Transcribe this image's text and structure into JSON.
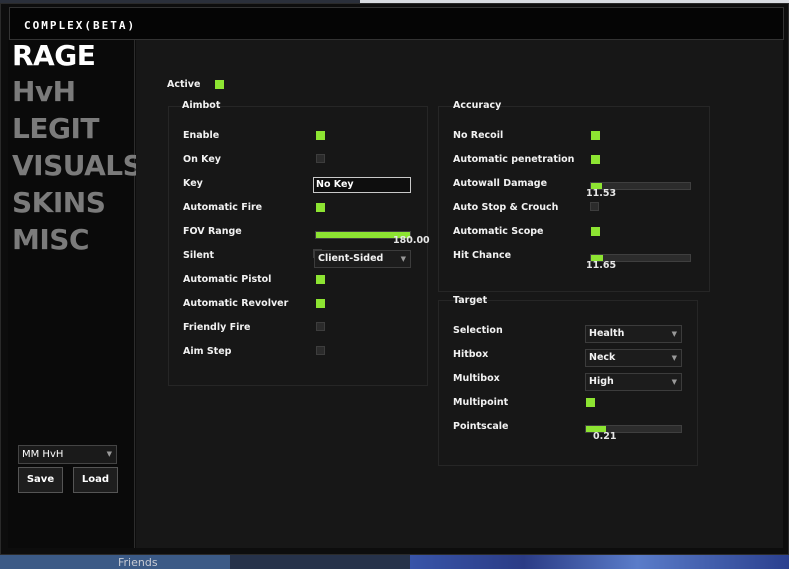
{
  "window": {
    "title": "COMPLEX(BETA)"
  },
  "sidebar": {
    "items": [
      {
        "label": "RAGE"
      },
      {
        "label": "HvH"
      },
      {
        "label": "LEGIT"
      },
      {
        "label": "VISUALS"
      },
      {
        "label": "SKINS"
      },
      {
        "label": "MISC"
      }
    ],
    "active": "RAGE",
    "config_select": "MM HvH",
    "save_label": "Save",
    "load_label": "Load"
  },
  "main": {
    "active_label": "Active",
    "active_checked": true,
    "aimbot": {
      "title": "Aimbot",
      "enable": {
        "label": "Enable",
        "checked": true
      },
      "on_key": {
        "label": "On Key",
        "checked": false
      },
      "key": {
        "label": "Key",
        "value": "No Key"
      },
      "automatic_fire": {
        "label": "Automatic Fire",
        "checked": true
      },
      "fov_range": {
        "label": "FOV Range",
        "value": "180.00",
        "fraction": 1.0
      },
      "silent": {
        "label": "Silent",
        "checked": false,
        "mode": "Client-Sided"
      },
      "automatic_pistol": {
        "label": "Automatic Pistol",
        "checked": true
      },
      "automatic_revolver": {
        "label": "Automatic Revolver",
        "checked": true
      },
      "friendly_fire": {
        "label": "Friendly Fire",
        "checked": false
      },
      "aim_step": {
        "label": "Aim Step",
        "checked": false
      }
    },
    "accuracy": {
      "title": "Accuracy",
      "no_recoil": {
        "label": "No Recoil",
        "checked": true
      },
      "automatic_penetration": {
        "label": "Automatic penetration",
        "checked": true
      },
      "autowall_damage": {
        "label": "Autowall Damage",
        "value": "11.53",
        "fraction": 0.1153
      },
      "auto_stop_crouch": {
        "label": "Auto Stop & Crouch",
        "checked": false
      },
      "automatic_scope": {
        "label": "Automatic Scope",
        "checked": true
      },
      "hit_chance": {
        "label": "Hit Chance",
        "value": "11.65",
        "fraction": 0.1165
      }
    },
    "target": {
      "title": "Target",
      "selection": {
        "label": "Selection",
        "value": "Health"
      },
      "hitbox": {
        "label": "Hitbox",
        "value": "Neck"
      },
      "multibox": {
        "label": "Multibox",
        "value": "High"
      },
      "multipoint": {
        "label": "Multipoint",
        "checked": true
      },
      "pointscale": {
        "label": "Pointscale",
        "value": "0.21",
        "fraction": 0.21
      }
    }
  },
  "background": {
    "friends_label": "Friends"
  },
  "colors": {
    "accent": "#8de432",
    "panel": "#171717",
    "window": "#0d0d0d"
  }
}
